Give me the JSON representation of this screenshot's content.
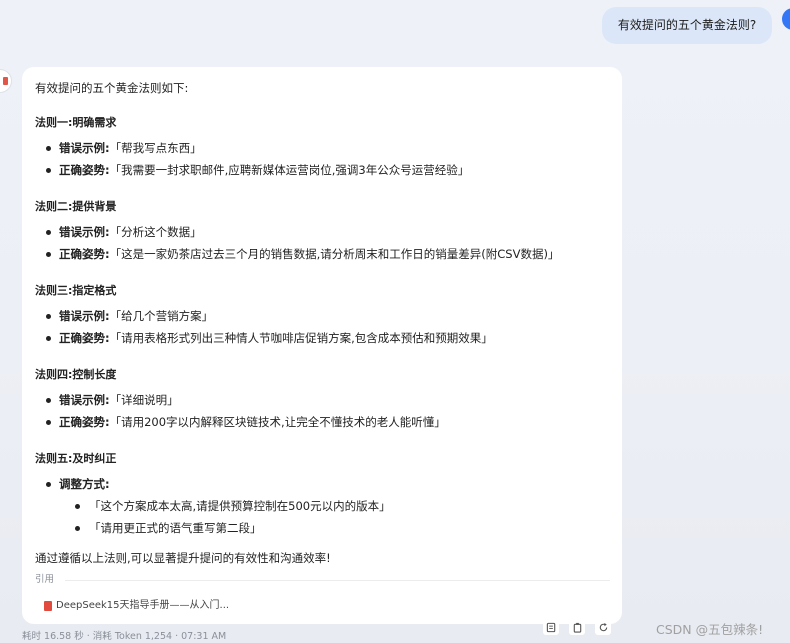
{
  "user": {
    "message": "有效提问的五个黄金法则?"
  },
  "answer": {
    "intro": "有效提问的五个黄金法则如下:",
    "rules": [
      {
        "title": "法则一:明确需求",
        "wrong_label": "错误示例:",
        "wrong": "「帮我写点东西」",
        "right_label": "正确姿势:",
        "right": "「我需要一封求职邮件,应聘新媒体运营岗位,强调3年公众号运营经验」"
      },
      {
        "title": "法则二:提供背景",
        "wrong_label": "错误示例:",
        "wrong": "「分析这个数据」",
        "right_label": "正确姿势:",
        "right": "「这是一家奶茶店过去三个月的销售数据,请分析周末和工作日的销量差异(附CSV数据)」"
      },
      {
        "title": "法则三:指定格式",
        "wrong_label": "错误示例:",
        "wrong": "「给几个营销方案」",
        "right_label": "正确姿势:",
        "right": "「请用表格形式列出三种情人节咖啡店促销方案,包含成本预估和预期效果」"
      },
      {
        "title": "法则四:控制长度",
        "wrong_label": "错误示例:",
        "wrong": "「详细说明」",
        "right_label": "正确姿势:",
        "right": "「请用200字以内解释区块链技术,让完全不懂技术的老人能听懂」"
      }
    ],
    "rule5": {
      "title": "法则五:及时纠正",
      "adjust_label": "调整方式:",
      "items": [
        "「这个方案成本太高,请提供预算控制在500元以内的版本」",
        "「请用更正式的语气重写第二段」"
      ]
    },
    "outro": "通过遵循以上法则,可以显著提升提问的有效性和沟通效率!",
    "quote_label": "引用",
    "reference": "DeepSeek15天指导手册——从入门..."
  },
  "meta": "耗时 16.58 秒 · 消耗 Token 1,254 · 07:31 AM",
  "watermark": "CSDN @五包辣条!",
  "colors": {
    "accent": "#3477f6",
    "user_bubble": "#dbe7f8",
    "pdf": "#e04a3f"
  }
}
